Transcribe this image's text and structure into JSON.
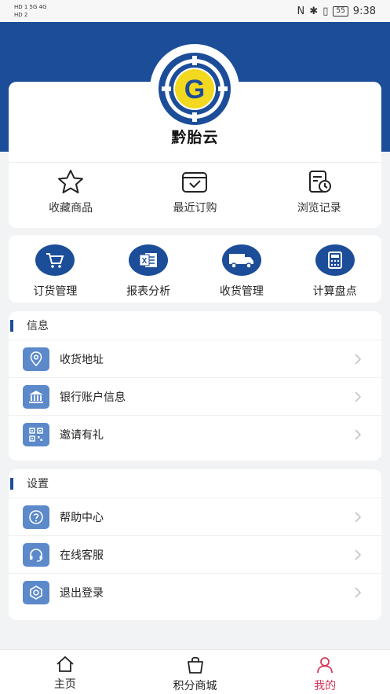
{
  "status_bar": {
    "left_top": "HD 1  5G  4G",
    "left_bottom": "HD 2",
    "battery": "55",
    "time": "9:38"
  },
  "profile": {
    "name": "黔胎云",
    "logo_letter": "G"
  },
  "quick_actions": [
    {
      "label": "收藏商品",
      "icon": "star-icon"
    },
    {
      "label": "最近订购",
      "icon": "box-check-icon"
    },
    {
      "label": "浏览记录",
      "icon": "history-icon"
    }
  ],
  "functions": [
    {
      "label": "订货管理",
      "icon": "cart-icon"
    },
    {
      "label": "报表分析",
      "icon": "excel-icon"
    },
    {
      "label": "收货管理",
      "icon": "truck-icon"
    },
    {
      "label": "计算盘点",
      "icon": "calculator-icon"
    }
  ],
  "info_section": {
    "title": "信息",
    "items": [
      {
        "label": "收货地址",
        "icon": "location-icon"
      },
      {
        "label": "银行账户信息",
        "icon": "bank-icon"
      },
      {
        "label": "邀请有礼",
        "icon": "qrcode-icon"
      }
    ]
  },
  "settings_section": {
    "title": "设置",
    "items": [
      {
        "label": "帮助中心",
        "icon": "help-icon"
      },
      {
        "label": "在线客服",
        "icon": "headset-icon"
      },
      {
        "label": "退出登录",
        "icon": "logout-icon"
      }
    ]
  },
  "tabbar": {
    "items": [
      {
        "label": "主页",
        "icon": "home-icon"
      },
      {
        "label": "积分商城",
        "icon": "bag-icon"
      },
      {
        "label": "我的",
        "icon": "user-icon"
      }
    ],
    "active": "我的"
  },
  "colors": {
    "brand_blue": "#1c4d98",
    "item_icon_blue": "#5b89c9",
    "active_tab": "#d43a5b",
    "logo_yellow": "#f2d81e"
  }
}
